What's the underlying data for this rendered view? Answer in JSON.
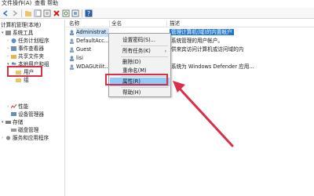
{
  "menubar": {
    "items": [
      "文件",
      "操作(A)",
      "查看",
      "帮助"
    ]
  },
  "tree": {
    "items": [
      {
        "label": "计算机管理(本地)"
      },
      {
        "label": "系统工具"
      },
      {
        "label": "任务计划程序"
      },
      {
        "label": "事件查看器"
      },
      {
        "label": "共享文件夹"
      },
      {
        "label": "本地用户和组"
      },
      {
        "label": "用户"
      },
      {
        "label": "组"
      },
      {
        "label": "性能"
      },
      {
        "label": "设备管理器"
      },
      {
        "label": "存储"
      },
      {
        "label": "磁盘管理"
      },
      {
        "label": "服务和应用程序"
      }
    ]
  },
  "list": {
    "columns": [
      "名称",
      "全名",
      "描述"
    ],
    "rows": [
      {
        "name": "Administrat...",
        "fullname": "",
        "desc": "管理计算机(域)的内置帐户"
      },
      {
        "name": "DefaultAcc...",
        "fullname": "",
        "desc": "系统管理的用户帐户。"
      },
      {
        "name": "Guest",
        "fullname": "",
        "desc": "供来宾访问计算机或访问域的内"
      },
      {
        "name": "lisi",
        "fullname": "",
        "desc": ""
      },
      {
        "name": "WDAGUtilit...",
        "fullname": "",
        "desc": "系统为 Windows Defender 应用..."
      }
    ]
  },
  "context_menu": {
    "items": [
      {
        "label": "设置密码(S)..."
      },
      {
        "label": "所有任务(K)",
        "submenu": "›"
      },
      {
        "label": "删除(D)"
      },
      {
        "label": "重命名(M)"
      },
      {
        "label": "属性(R)"
      },
      {
        "label": "帮助(H)"
      }
    ]
  },
  "colors": {
    "highlight_red": "#d9304a",
    "selection_blue": "#1e78d6",
    "menu_hover": "#91c9f7"
  }
}
